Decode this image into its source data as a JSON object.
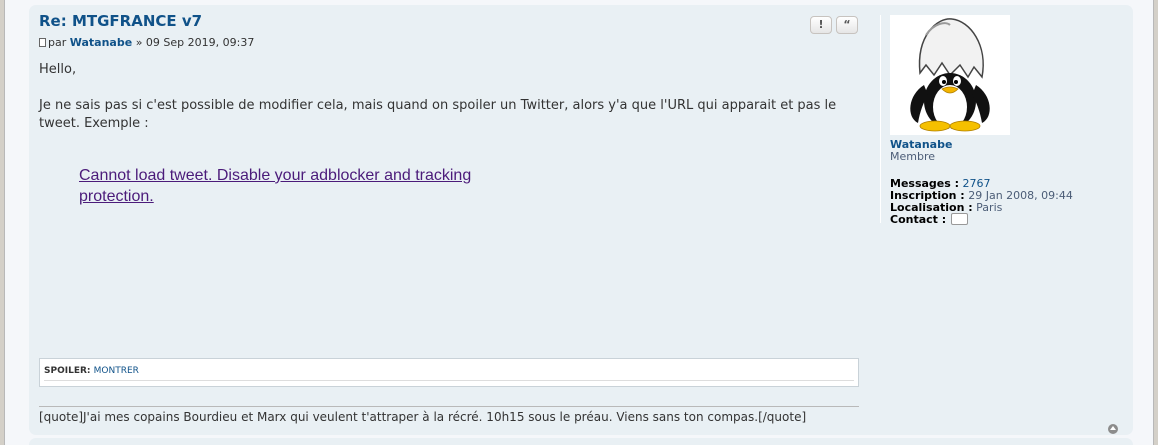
{
  "post": {
    "title": "Re: MTGFRANCE v7",
    "by": "par",
    "author": "Watanabe",
    "date": "» 09 Sep 2019, 09:37",
    "report_button": "!",
    "quote_button": "“",
    "paragraphs": [
      "Hello,",
      "Je ne sais pas si c'est possible de modifier cela, mais quand on spoiler un Twitter, alors y'a que l'URL qui apparait et pas le tweet. Exemple :"
    ],
    "tweet_notice": "Cannot load tweet. Disable your adblocker and tracking protection.",
    "spoiler": {
      "label": "SPOILER:",
      "toggle": "MONTRER"
    },
    "signature": "[quote]J'ai mes copains Bourdieu et Marx qui veulent t'attraper à la récré. 10h15 sous le préau. Viens sans ton compas.[/quote]"
  },
  "profile": {
    "username": "Watanabe",
    "rank": "Membre",
    "messages_label": "Messages :",
    "messages_value": "2767",
    "inscription_label": "Inscription :",
    "inscription_value": "29 Jan 2008, 09:44",
    "localisation_label": "Localisation :",
    "localisation_value": "Paris",
    "contact_label": "Contact :",
    "avatar_icon": "tux-penguin-eggshell-avatar",
    "contact_icon": "speech-bubble-icon"
  },
  "icons": {
    "post_icon": "file-icon",
    "back_to_top": "arrow-up-icon"
  },
  "colors": {
    "link": "#105289",
    "post_bg": "#e9f0f4",
    "tweet_link": "#4b1b7a"
  }
}
